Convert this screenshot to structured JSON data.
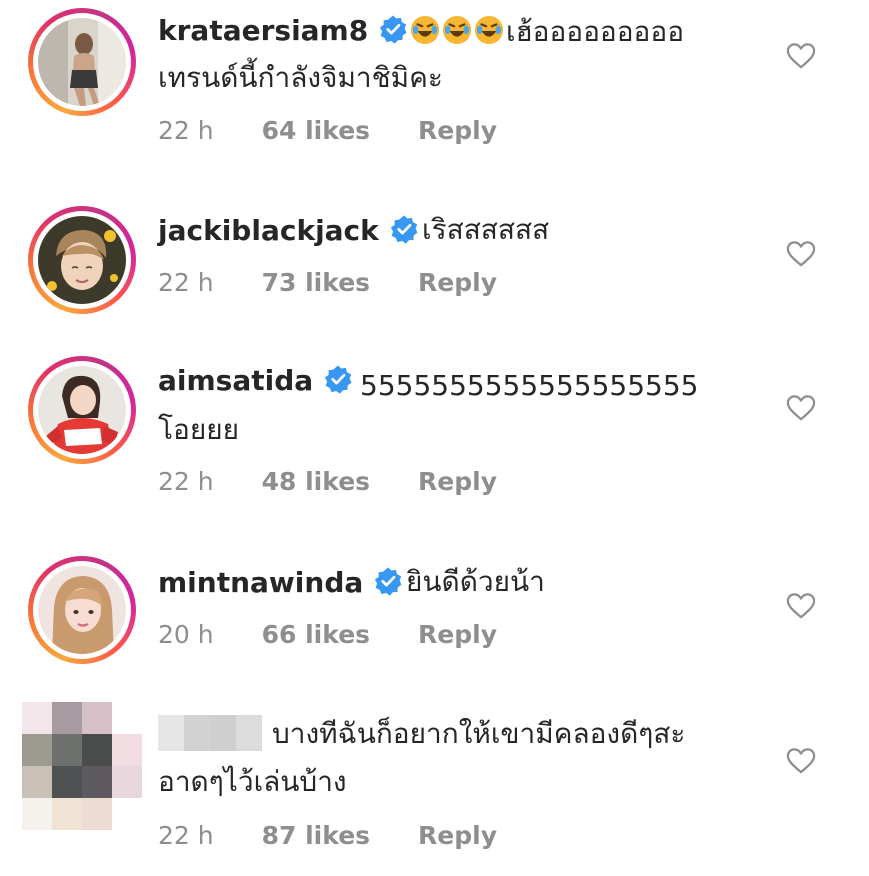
{
  "comments": [
    {
      "username": "krataersiam8",
      "verified": true,
      "emoji_count": 3,
      "text_line1": "เฮ้อออออออออ",
      "text_line2": "เทรนด์นี้กำลังจิมาชิมิคะ",
      "time": "22 h",
      "likes": "64 likes",
      "reply": "Reply"
    },
    {
      "username": "jackiblackjack",
      "verified": true,
      "text_line1": "เริสสสสสส",
      "time": "22 h",
      "likes": "73 likes",
      "reply": "Reply"
    },
    {
      "username": "aimsatida",
      "verified": true,
      "text_line1": "5555555555555555555",
      "text_line2": "โอยยย",
      "time": "22 h",
      "likes": "48 likes",
      "reply": "Reply"
    },
    {
      "username": "mintnawinda",
      "verified": true,
      "text_line1": "ยินดีด้วยน้า",
      "time": "20 h",
      "likes": "66 likes",
      "reply": "Reply"
    },
    {
      "username_blurred": true,
      "verified": false,
      "text_line1": "บางทีฉันก็อยากให้เขามีคลองดีๆสะ",
      "text_line2": "อาดๆไว้เล่นบ้าง",
      "time": "22 h",
      "likes": "87 likes",
      "reply": "Reply"
    }
  ],
  "icons": {
    "verified": "verified-badge-icon",
    "heart": "heart-outline-icon",
    "emoji": "rolling-laughing-emoji-icon"
  },
  "colors": {
    "text": "#262626",
    "meta": "#8e8e8e",
    "verified": "#3897f0",
    "story_ring_start": "#f9a73e",
    "story_ring_end": "#c13584"
  }
}
